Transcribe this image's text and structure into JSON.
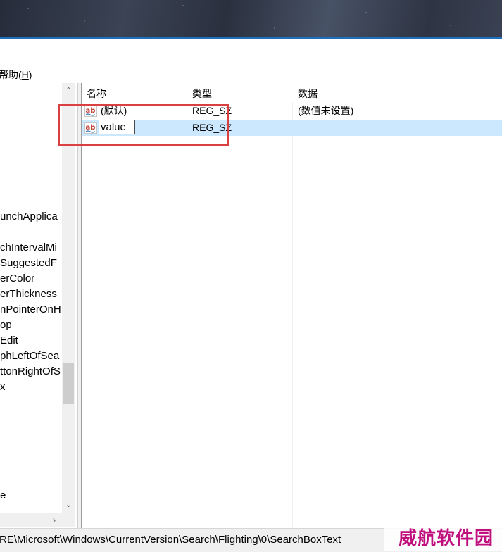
{
  "menu": {
    "help_text": "帮助",
    "help_key": "H"
  },
  "tree": {
    "items": [
      "unchApplica",
      "chIntervalMi",
      "SuggestedF",
      "erColor",
      "erThickness",
      "nPointerOnH",
      "op",
      "Edit",
      "phLeftOfSea",
      "ttonRightOfS",
      "x",
      "e"
    ]
  },
  "list": {
    "headers": {
      "name": "名称",
      "type": "类型",
      "data": "数据"
    },
    "rows": [
      {
        "name": "(默认)",
        "type": "REG_SZ",
        "data": "(数值未设置)",
        "icon": "ab-string-icon",
        "selected": false
      },
      {
        "name": "value",
        "type": "REG_SZ",
        "data": "",
        "icon": "ab-string-icon",
        "selected": true,
        "editing": true
      }
    ]
  },
  "status": {
    "path": "RE\\Microsoft\\Windows\\CurrentVersion\\Search\\Flighting\\0\\SearchBoxText"
  },
  "watermark": {
    "text": "威航软件园",
    "color": "#c0107d"
  },
  "colors": {
    "selection": "#cce8ff",
    "highlight_box": "#d9403f",
    "title_accent": "#1f6fbd"
  }
}
